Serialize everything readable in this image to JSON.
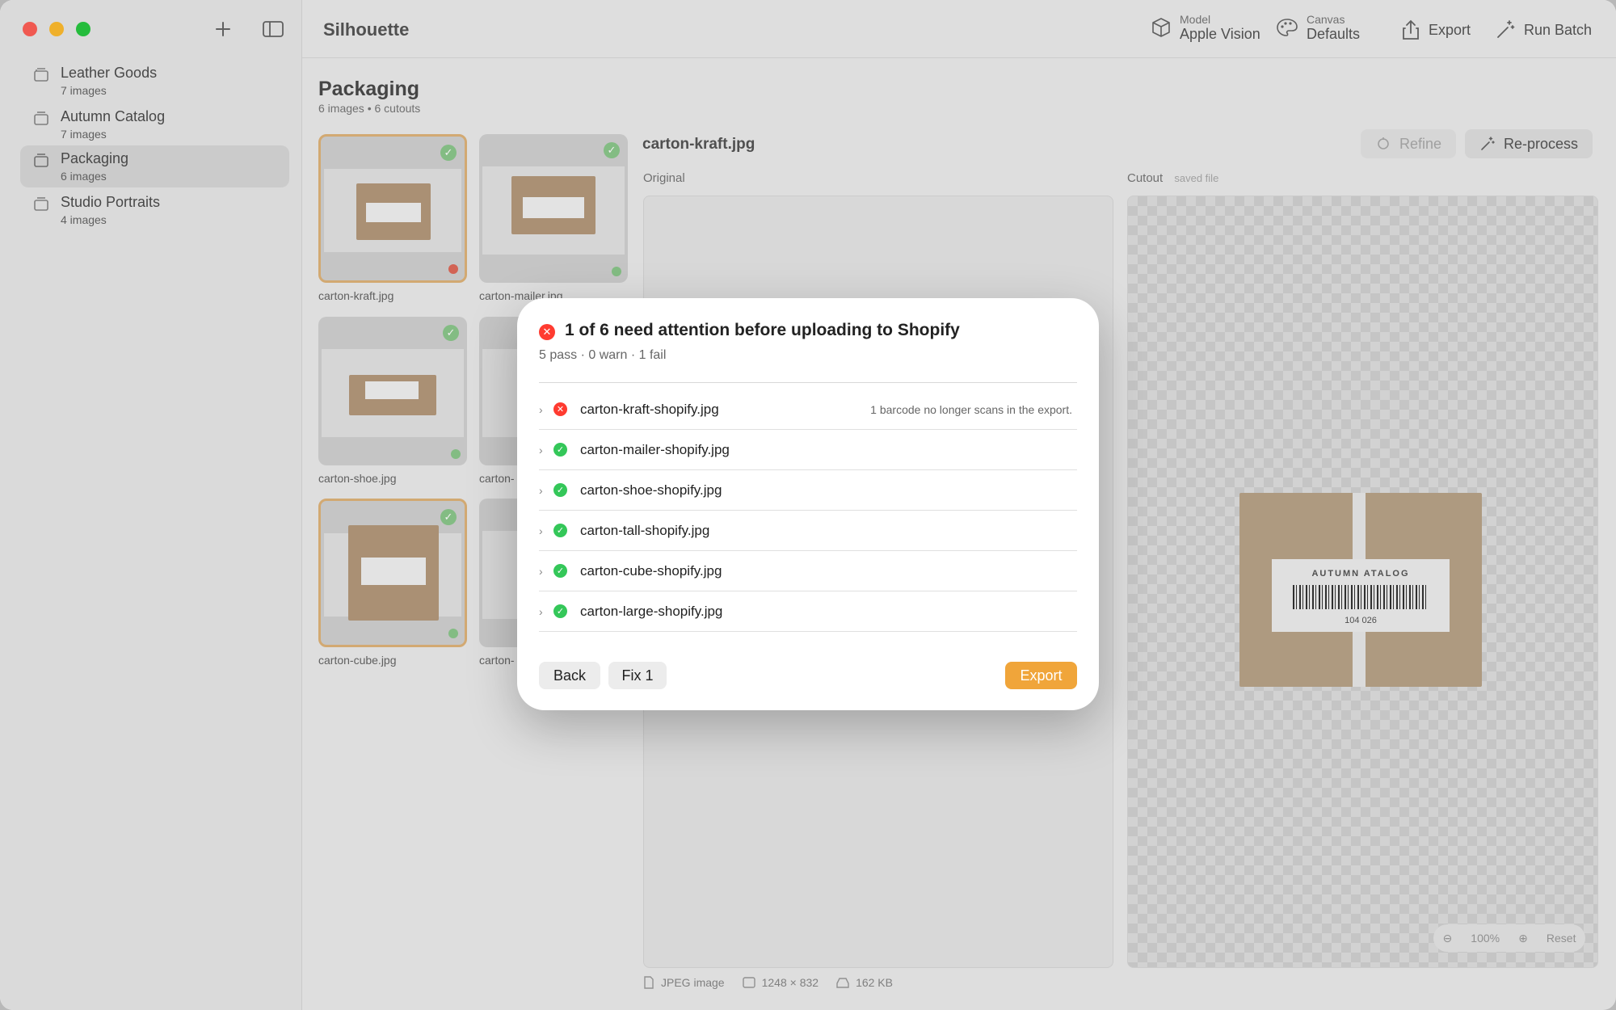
{
  "app": {
    "title": "Silhouette"
  },
  "sidebar": {
    "items": [
      {
        "label": "Leather Goods",
        "count": "7 images"
      },
      {
        "label": "Autumn Catalog",
        "count": "7 images"
      },
      {
        "label": "Packaging",
        "count": "6 images",
        "selected": true
      },
      {
        "label": "Studio Portraits",
        "count": "4 images"
      }
    ]
  },
  "toolbar": {
    "model_label": "Model",
    "model_value": "Apple Vision",
    "canvas_label": "Canvas",
    "canvas_value": "Defaults",
    "export_label": "Export",
    "run_batch_label": "Run Batch"
  },
  "gallery": {
    "title": "Packaging",
    "subtitle": "6 images • 6 cutouts",
    "thumbs": [
      {
        "name": "carton-kraft.jpg"
      },
      {
        "name": "carton-mailer.jpg"
      },
      {
        "name": "carton-shoe.jpg"
      },
      {
        "name": "carton-"
      },
      {
        "name": "carton-cube.jpg"
      },
      {
        "name": "carton-"
      }
    ]
  },
  "detail": {
    "filename": "carton-kraft.jpg",
    "refine_label": "Refine",
    "reprocess_label": "Re-process",
    "original_label": "Original",
    "cutout_label": "Cutout",
    "cutout_hint": "saved file",
    "file_type": "JPEG image",
    "dimensions": "1248 × 832",
    "file_size": "162 KB",
    "zoom": "100%",
    "reset_label": "Reset"
  },
  "modal": {
    "title": "1 of 6 need attention before uploading to Shopify",
    "summary": "5 pass · 0 warn · 1 fail",
    "rows": [
      {
        "file": "carton-kraft-shopify.jpg",
        "status": "fail",
        "note": "1 barcode no longer scans in the export."
      },
      {
        "file": "carton-mailer-shopify.jpg",
        "status": "pass",
        "note": ""
      },
      {
        "file": "carton-shoe-shopify.jpg",
        "status": "pass",
        "note": ""
      },
      {
        "file": "carton-tall-shopify.jpg",
        "status": "pass",
        "note": ""
      },
      {
        "file": "carton-cube-shopify.jpg",
        "status": "pass",
        "note": ""
      },
      {
        "file": "carton-large-shopify.jpg",
        "status": "pass",
        "note": ""
      }
    ],
    "back_label": "Back",
    "fix_label": "Fix 1",
    "export_label": "Export"
  },
  "colors": {
    "accent": "#f0a53a",
    "pass": "#34c759",
    "fail": "#ff3b30"
  }
}
